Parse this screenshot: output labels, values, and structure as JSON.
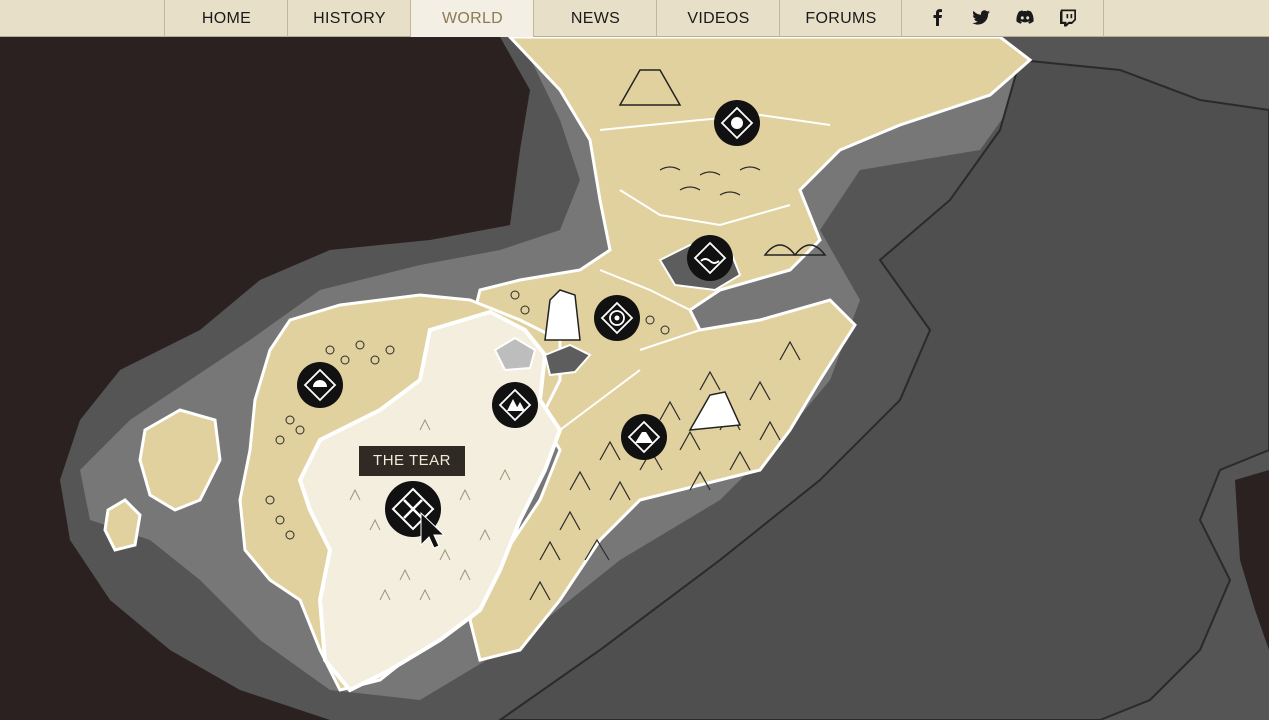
{
  "nav": {
    "items": [
      {
        "label": "HOME",
        "active": false
      },
      {
        "label": "HISTORY",
        "active": false
      },
      {
        "label": "WORLD",
        "active": true
      },
      {
        "label": "NEWS",
        "active": false
      },
      {
        "label": "VIDEOS",
        "active": false
      },
      {
        "label": "FORUMS",
        "active": false
      }
    ],
    "social": [
      "facebook-icon",
      "twitter-icon",
      "discord-icon",
      "twitch-icon"
    ]
  },
  "map": {
    "tooltip": "THE TEAR",
    "colors": {
      "background": "#2b2120",
      "sea": "#555555",
      "shallow": "#7a7a7a",
      "land": "#e1d19e",
      "highlight_region": "#f3eedd",
      "marker": "#111111"
    },
    "markers": [
      "diamond-dot-marker",
      "wave-marker",
      "target-marker",
      "sun-marker",
      "mountain-marker",
      "volcano-marker",
      "crossed-swords-marker"
    ]
  }
}
